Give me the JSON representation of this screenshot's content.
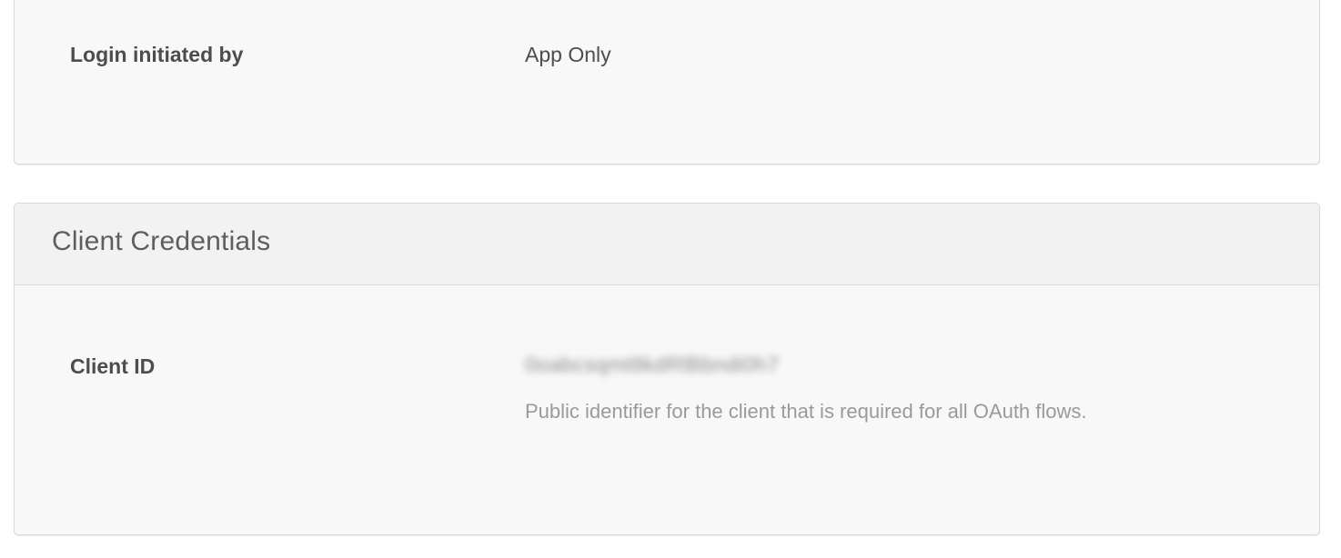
{
  "login_section": {
    "label": "Login initiated by",
    "value": "App Only"
  },
  "client_credentials": {
    "title": "Client Credentials",
    "client_id": {
      "label": "Client ID",
      "value": "0oabcsqmt8kdRlBbndi0h7",
      "help_text": "Public identifier for the client that is required for all OAuth flows."
    }
  }
}
